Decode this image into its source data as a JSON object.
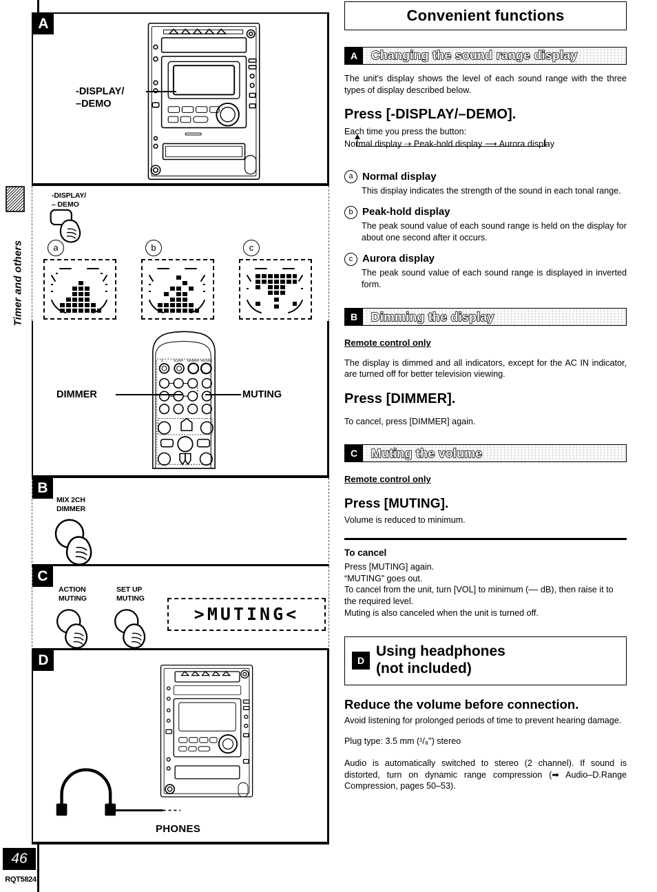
{
  "sidebar": {
    "tab_label": "Timer and others",
    "page_number": "46",
    "doc_code": "RQT5824"
  },
  "figures": {
    "panel_a": {
      "badge": "A",
      "callout": "-DISPLAY/\n–DEMO",
      "device_caption": ""
    },
    "panel_modes": {
      "button_caption": "-DISPLAY/\n– DEMO",
      "items": [
        {
          "marker": "a"
        },
        {
          "marker": "b"
        },
        {
          "marker": "c"
        }
      ]
    },
    "panel_remote": {
      "left_label": "DIMMER",
      "right_label": "MUTING"
    },
    "panel_b": {
      "badge": "B",
      "button_caption": "MIX 2CH\nDIMMER"
    },
    "panel_c": {
      "badge": "C",
      "button_caption_1": "ACTION\nMUTING",
      "button_caption_2": "SET UP\nMUTING",
      "lcd_text": ">MUTING<"
    },
    "panel_d": {
      "badge": "D",
      "caption": "PHONES"
    }
  },
  "content": {
    "page_title": "Convenient functions",
    "sections": [
      {
        "tag": "A",
        "banner": "Changing the sound range display",
        "intro": "The unit's display shows the level of each sound range with the three types of display described below.",
        "press_heading": "Press [-DISPLAY/–DEMO].",
        "cycle_intro": "Each time you press the button:",
        "cycle_line": "Normal display ⇢ Peak-hold display ⟶ Aurora display",
        "modes": [
          {
            "marker": "a",
            "title": "Normal display",
            "body": "This display indicates the strength of the sound in each tonal range."
          },
          {
            "marker": "b",
            "title": "Peak-hold display",
            "body": "The peak sound value of each sound range is held on the display for about one second after it occurs."
          },
          {
            "marker": "c",
            "title": "Aurora display",
            "body": "The peak sound value of each sound range is displayed in inverted form."
          }
        ]
      },
      {
        "tag": "B",
        "banner": "Dimming the display",
        "note": "Remote control only",
        "intro": "The display is dimmed and all indicators, except for the AC IN indicator, are turned off for better television viewing.",
        "press_heading": "Press [DIMMER].",
        "cancel": "To cancel, press [DIMMER] again."
      },
      {
        "tag": "C",
        "banner": "Muting the volume",
        "note": "Remote control only",
        "press_heading": "Press [MUTING].",
        "press_sub": "Volume is reduced to minimum.",
        "cancel_title": "To cancel",
        "cancel_lines": [
          "Press [MUTING] again.",
          "“MUTING” goes out.",
          "To cancel from the unit, turn [VOL] to minimum (–– dB), then raise it to the required level.",
          "Muting is also canceled when the unit is turned off."
        ]
      },
      {
        "tag": "D",
        "box_title": "Using headphones\n(not included)",
        "lead": "Reduce the volume before connection.",
        "body_1": "Avoid listening for prolonged periods of time to prevent hearing damage.",
        "plug": "Plug type:  3.5 mm (¹/₈\") stereo",
        "body_2": "Audio is automatically switched to stereo (2 channel). If sound is distorted, turn on dynamic range compression (➡ Audio–D.Range Compression, pages 50–53)."
      }
    ]
  }
}
